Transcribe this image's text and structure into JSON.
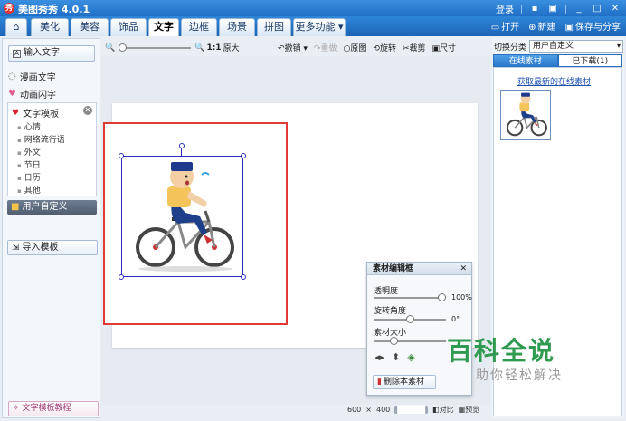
{
  "app": {
    "title": "美图秀秀 4.0.1",
    "logo_glyph": "秀",
    "login": "登录"
  },
  "tabs": [
    {
      "label": "美化"
    },
    {
      "label": "美容"
    },
    {
      "label": "饰品"
    },
    {
      "label": "文字",
      "active": true
    },
    {
      "label": "边框"
    },
    {
      "label": "场景"
    },
    {
      "label": "拼图"
    },
    {
      "label": "更多功能 ▾"
    }
  ],
  "tab_actions": {
    "open": "打开",
    "new": "新建",
    "save": "保存与分享"
  },
  "left": {
    "input_text": "输入文字",
    "comic_text": "漫画文字",
    "anim_text": "动画闪字",
    "template_title": "文字模板",
    "template_items": [
      "心情",
      "网络流行语",
      "外文",
      "节日",
      "日历",
      "其他"
    ],
    "user_defined": "用户自定义",
    "import_template": "导入模板",
    "tutorial": "文字模板教程"
  },
  "toolbar": {
    "zoom_ratio": "1:1",
    "original_size": "原大",
    "undo": "撤销",
    "redo": "重做",
    "original_image": "原图",
    "rotate": "旋转",
    "crop": "裁剪",
    "size": "尺寸"
  },
  "status": {
    "width": "600",
    "times": "×",
    "height": "400",
    "chip": "█████",
    "compare": "对比",
    "preview": "预览"
  },
  "editor": {
    "title": "素材编辑框",
    "opacity_label": "透明度",
    "opacity_value": "100%",
    "opacity_fraction": 1.0,
    "rotate_label": "旋转角度",
    "rotate_value": "0°",
    "rotate_fraction": 0.5,
    "size_label": "素材大小",
    "size_fraction": 0.25,
    "delete_button": "删除本素材"
  },
  "right": {
    "category_label": "切换分类",
    "category_value": "用户自定义",
    "tab_online": "在线素材",
    "tab_downloaded": "已下载(1)",
    "link": "获取最新的在线素材"
  },
  "watermark": {
    "title": "百科全说",
    "subtitle": "助你轻松解决"
  },
  "colors": {
    "titlebar": "#2f86d9",
    "frame_red": "#e03a35",
    "selection_blue": "#2a2ec0",
    "watermark_green": "#2f9a50"
  }
}
